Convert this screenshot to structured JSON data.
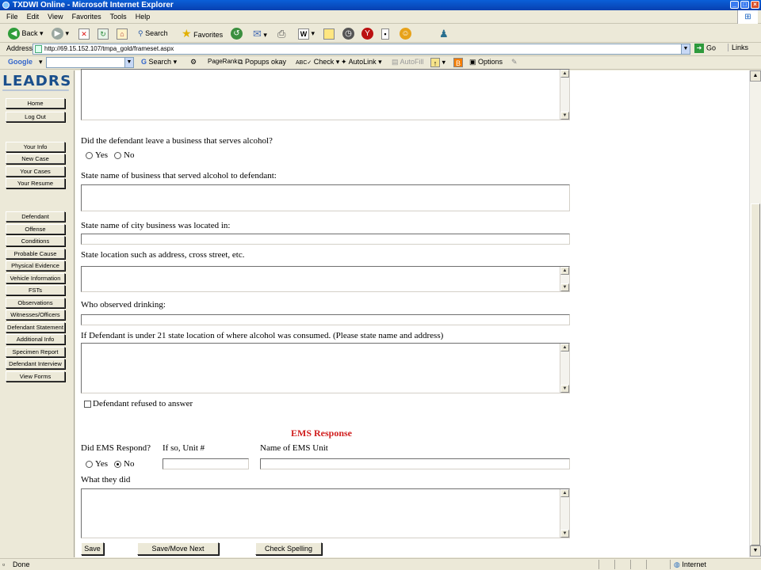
{
  "window": {
    "title": "TXDWI Online - Microsoft Internet Explorer",
    "controls": [
      "_",
      "□",
      "×"
    ]
  },
  "menu": [
    "File",
    "Edit",
    "View",
    "Favorites",
    "Tools",
    "Help"
  ],
  "toolbar": {
    "back": "Back",
    "search": "Search",
    "favorites": "Favorites"
  },
  "address": {
    "label": "Address",
    "url": "http://69.15.152.107/tmpa_gold/frameset.aspx",
    "go": "Go",
    "links": "Links"
  },
  "googlebar": {
    "logo": "Google",
    "search": "Search",
    "pagerank": "PageRank",
    "popups": "Popups okay",
    "check": "Check",
    "autolink": "AutoLink",
    "autofill": "AutoFill",
    "options": "Options"
  },
  "sidebar": {
    "logo": "LEADRS",
    "group1": [
      "Home",
      "Log Out"
    ],
    "group2": [
      "Your Info",
      "New Case",
      "Your Cases",
      "Your Resume"
    ],
    "group3": [
      "Defendant",
      "Offense",
      "Conditions",
      "Probable Cause",
      "Physical Evidence",
      "Vehicle Information",
      "FSTs",
      "Observations",
      "Witnesses/Officers",
      "Defendant Statement",
      "Additional Info",
      "Specimen Report",
      "Defendant Interview",
      "View Forms"
    ]
  },
  "form": {
    "q_business": "Did the defendant leave a business that serves alcohol?",
    "yes": "Yes",
    "no": "No",
    "q_business_name": "State name of business that served alcohol to defendant:",
    "q_city": "State name of city business was located in:",
    "q_location": "State location such as address, cross street, etc.",
    "q_observed": "Who observed drinking:",
    "q_under21": "If Defendant is under 21 state location of where alcohol was consumed. (Please state name and address)",
    "refused": "Defendant refused to answer",
    "ems_heading": "EMS Response",
    "q_ems": "Did EMS Respond?",
    "unit_label": "If so, Unit #",
    "ems_name_label": "Name of EMS Unit",
    "what_they_did": "What they did",
    "ems_responded": "No"
  },
  "buttons": {
    "save": "Save",
    "save_next": "Save/Move Next",
    "spell": "Check Spelling"
  },
  "status": {
    "left": "Done",
    "zone": "Internet"
  }
}
